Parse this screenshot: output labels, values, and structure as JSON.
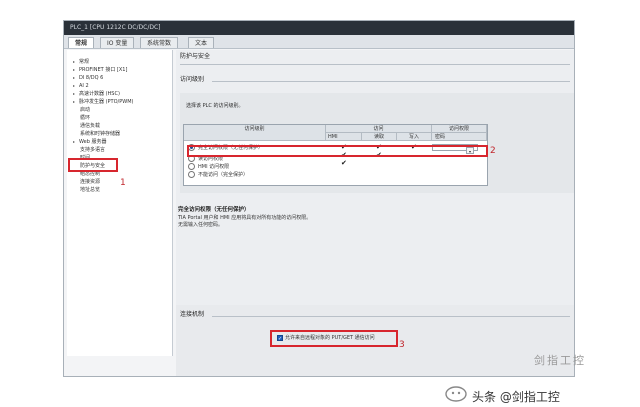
{
  "window": {
    "title": "PLC_1 [CPU 1212C DC/DC/DC]"
  },
  "tabs": [
    {
      "label": "常规",
      "active": true
    },
    {
      "label": "IO 变量",
      "active": false
    },
    {
      "label": "系统常数",
      "active": false
    },
    {
      "label": "文本",
      "active": false
    }
  ],
  "sidebar": {
    "items": [
      {
        "label": "常规",
        "arrow": "▸",
        "sub": false
      },
      {
        "label": "PROFINET 接口 [X1]",
        "arrow": "▸",
        "sub": false
      },
      {
        "label": "DI 8/DQ 6",
        "arrow": "▸",
        "sub": false
      },
      {
        "label": "AI 2",
        "arrow": "▸",
        "sub": false
      },
      {
        "label": "高速计数器 (HSC)",
        "arrow": "▸",
        "sub": false
      },
      {
        "label": "脉冲发生器 (PTO/PWM)",
        "arrow": "▸",
        "sub": false
      },
      {
        "label": "启动",
        "arrow": "",
        "sub": true
      },
      {
        "label": "循环",
        "arrow": "",
        "sub": true
      },
      {
        "label": "通信负载",
        "arrow": "",
        "sub": true
      },
      {
        "label": "系统和时钟存储器",
        "arrow": "",
        "sub": true
      },
      {
        "label": "Web 服务器",
        "arrow": "▸",
        "sub": false
      },
      {
        "label": "支持多语言",
        "arrow": "",
        "sub": true
      },
      {
        "label": "时间",
        "arrow": "",
        "sub": true
      },
      {
        "label": "防护与安全",
        "arrow": "",
        "sub": true
      },
      {
        "label": "组态控制",
        "arrow": "",
        "sub": true
      },
      {
        "label": "连接资源",
        "arrow": "",
        "sub": true
      },
      {
        "label": "地址总览",
        "arrow": "",
        "sub": true
      }
    ]
  },
  "main": {
    "section_title": "防护与安全",
    "access_section": "访问级别",
    "instruction": "选择该 PLC 的访问级别。",
    "table": {
      "headers": {
        "level": "访问级别",
        "access": "访问",
        "permission": "访问权限"
      },
      "subheaders": {
        "hmi": "HMI",
        "read": "读取",
        "write": "写入",
        "password": "密码"
      },
      "rows": [
        {
          "label": "完全访问权限（无任何保护）",
          "selected": true,
          "hmi": "✔",
          "read": "✔",
          "write": "✔"
        },
        {
          "label": "读访问权限",
          "selected": false,
          "hmi": "✔",
          "read": "✔",
          "write": ""
        },
        {
          "label": "HMI 访问权限",
          "selected": false,
          "hmi": "✔",
          "read": "",
          "write": ""
        },
        {
          "label": "不能访问（完全保护）",
          "selected": false,
          "hmi": "",
          "read": "",
          "write": ""
        }
      ]
    },
    "description": {
      "title": "完全访问权限（无任何保护）",
      "line1": "TIA Portal 用户和 HMI 应用将具有对所有功能的访问权限。",
      "line2": "无需输入任何密码。"
    },
    "connection_section": "连接机制",
    "checkbox": {
      "label": "允许来自远程对象的 PUT/GET 通信访问",
      "checked": true
    }
  },
  "callouts": {
    "one": "1",
    "two": "2",
    "three": "3"
  },
  "watermark": {
    "text": "头条 @剑指工控",
    "faint": "剑指工控"
  }
}
